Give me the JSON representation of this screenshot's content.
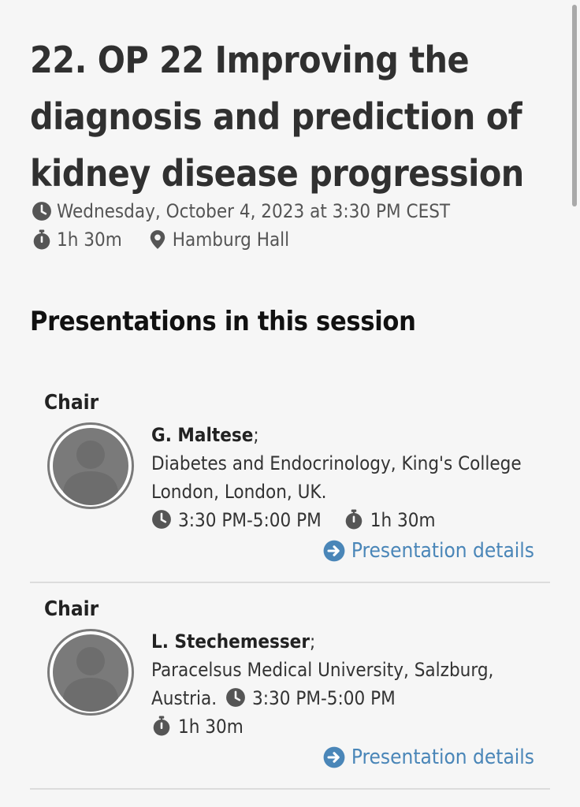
{
  "session": {
    "title": "22. OP 22 Improving the diagnosis and prediction of kidney disease progression",
    "datetime": "Wednesday, October 4, 2023 at 3:30 PM CEST",
    "duration": "1h 30m",
    "location": "Hamburg Hall"
  },
  "section_heading": "Presentations in this session",
  "presentations": [
    {
      "role": "Chair",
      "name": "G. Maltese",
      "name_suffix": ";",
      "affiliation": "Diabetes and Endocrinology, King's College London, London, UK.",
      "time": "3:30 PM-5:00 PM",
      "duration": "1h 30m",
      "details_label": "Presentation details"
    },
    {
      "role": "Chair",
      "name": "L. Stechemesser",
      "name_suffix": ";",
      "affiliation": "Paracelsus Medical University, Salzburg, Austria.",
      "time": "3:30 PM-5:00 PM",
      "duration": "1h 30m",
      "details_label": "Presentation details"
    }
  ],
  "icons": {
    "clock": "clock-icon",
    "stopwatch": "stopwatch-icon",
    "location": "location-pin-icon",
    "avatar": "user-avatar-icon",
    "arrow": "arrow-circle-right-icon"
  },
  "colors": {
    "link": "#4a86b8",
    "icon": "#555555",
    "avatar": "#7a7a7a",
    "background": "#f6f6f6"
  }
}
